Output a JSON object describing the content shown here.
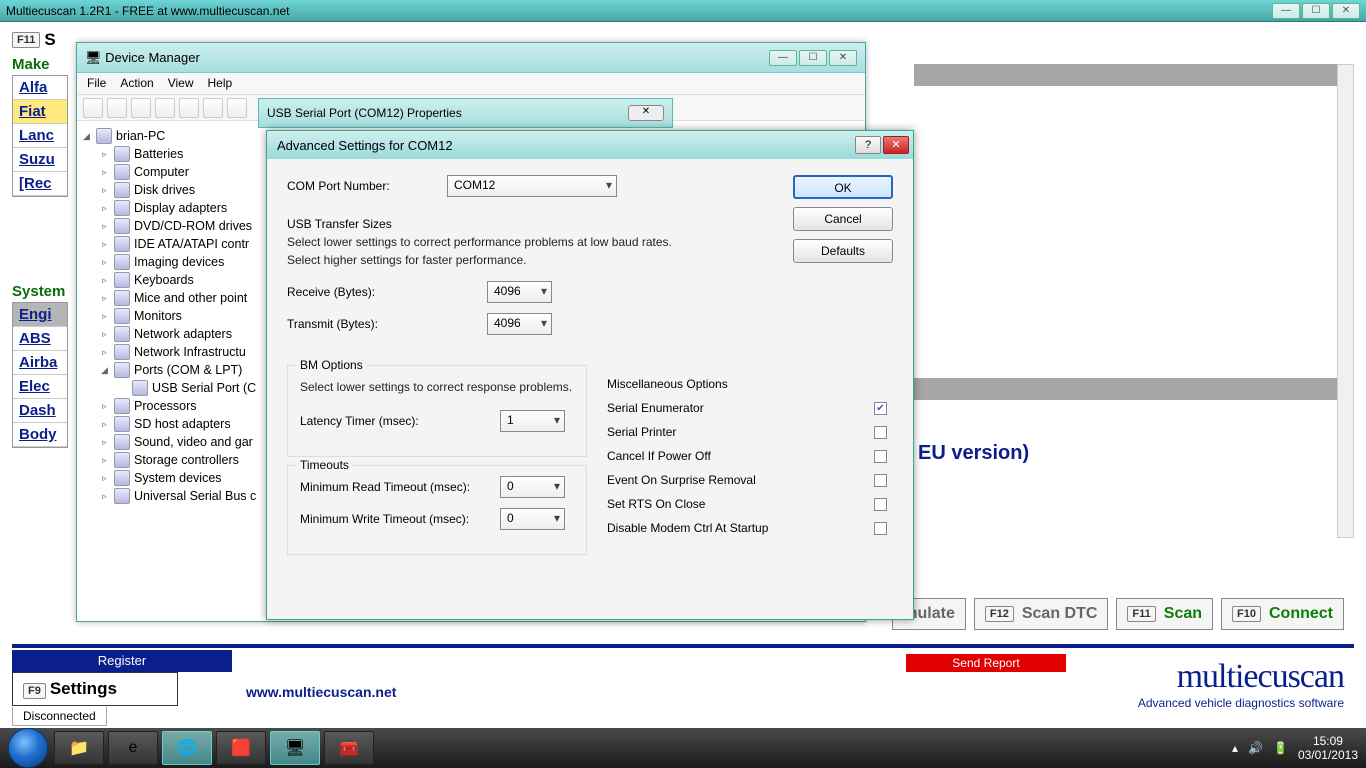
{
  "app": {
    "title": "Multiecuscan 1.2R1 - FREE at www.multiecuscan.net"
  },
  "mcu": {
    "make_label": "Make",
    "makes": [
      "Alfa",
      "Fiat",
      "Lanc",
      "Suzu",
      "[Rec"
    ],
    "system_label": "System",
    "systems": [
      "Engi",
      "ABS",
      "Airba",
      "Elec",
      "Dash",
      "Body"
    ],
    "eu": "EU version)",
    "simulate": "mulate",
    "scan_dtc": "Scan DTC",
    "scan": "Scan",
    "connect": "Connect",
    "register": "Register",
    "send_report": "Send Report",
    "settings": "Settings",
    "url": "www.multiecuscan.net",
    "logo_big": "multiecuscan",
    "logo_sub": "Advanced vehicle diagnostics software",
    "status": "Disconnected",
    "fkeys": {
      "top": "F11",
      "f12": "F12",
      "f11": "F11",
      "f10": "F10",
      "f9": "F9"
    }
  },
  "devmgr": {
    "title": "Device Manager",
    "menu": [
      "File",
      "Action",
      "View",
      "Help"
    ],
    "root": "brian-PC",
    "nodes": [
      "Batteries",
      "Computer",
      "Disk drives",
      "Display adapters",
      "DVD/CD-ROM drives",
      "IDE ATA/ATAPI contr",
      "Imaging devices",
      "Keyboards",
      "Mice and other point",
      "Monitors",
      "Network adapters",
      "Network Infrastructu"
    ],
    "ports": "Ports (COM & LPT)",
    "usb_port": "USB Serial Port (C",
    "nodes2": [
      "Processors",
      "SD host adapters",
      "Sound, video and gar",
      "Storage controllers",
      "System devices",
      "Universal Serial Bus c"
    ]
  },
  "props": {
    "title": "USB Serial Port (COM12) Properties"
  },
  "adv": {
    "title": "Advanced Settings for COM12",
    "com_label": "COM Port Number:",
    "com_value": "COM12",
    "ok": "OK",
    "cancel": "Cancel",
    "defaults": "Defaults",
    "usb_title": "USB Transfer Sizes",
    "hint1": "Select lower settings to correct performance problems at low baud rates.",
    "hint2": "Select higher settings for faster performance.",
    "receive": "Receive (Bytes):",
    "receive_val": "4096",
    "transmit": "Transmit (Bytes):",
    "transmit_val": "4096",
    "bm_title": "BM Options",
    "bm_hint": "Select lower settings to correct response problems.",
    "latency": "Latency Timer (msec):",
    "latency_val": "1",
    "timeouts_title": "Timeouts",
    "min_read": "Minimum Read Timeout (msec):",
    "min_read_val": "0",
    "min_write": "Minimum Write Timeout (msec):",
    "min_write_val": "0",
    "misc_title": "Miscellaneous Options",
    "misc": [
      {
        "label": "Serial Enumerator",
        "checked": true
      },
      {
        "label": "Serial Printer",
        "checked": false
      },
      {
        "label": "Cancel If Power Off",
        "checked": false
      },
      {
        "label": "Event On Surprise Removal",
        "checked": false
      },
      {
        "label": "Set RTS On Close",
        "checked": false
      },
      {
        "label": "Disable Modem Ctrl At Startup",
        "checked": false
      }
    ]
  },
  "taskbar": {
    "time": "15:09",
    "date": "03/01/2013"
  }
}
